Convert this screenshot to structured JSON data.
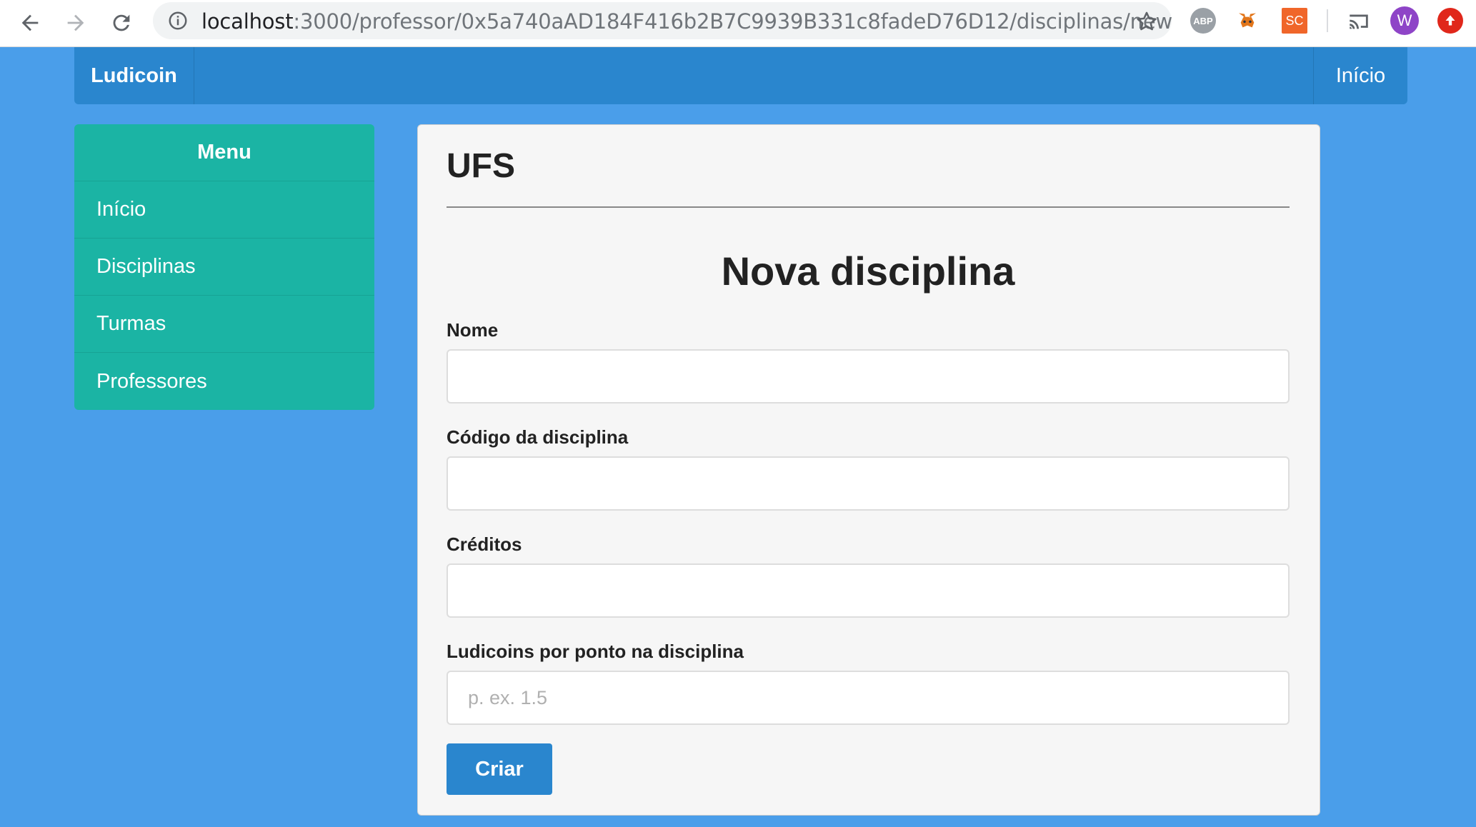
{
  "browser": {
    "url_host": "localhost",
    "url_path": ":3000/professor/0x5a740aAD184F416b2B7C9939B331c8fadeD76D12/disciplinas/new",
    "extensions": {
      "abp_label": "ABP",
      "sc_label": "SC",
      "avatar_letter": "W"
    }
  },
  "navbar": {
    "brand": "Ludicoin",
    "right_link": "Início"
  },
  "menu": {
    "header": "Menu",
    "items": [
      {
        "label": "Início"
      },
      {
        "label": "Disciplinas"
      },
      {
        "label": "Turmas"
      },
      {
        "label": "Professores"
      }
    ]
  },
  "main": {
    "institution": "UFS",
    "form_title": "Nova disciplina",
    "fields": [
      {
        "label": "Nome",
        "value": "",
        "placeholder": ""
      },
      {
        "label": "Código da disciplina",
        "value": "",
        "placeholder": ""
      },
      {
        "label": "Créditos",
        "value": "",
        "placeholder": ""
      },
      {
        "label": "Ludicoins por ponto na disciplina",
        "value": "",
        "placeholder": "p. ex. 1.5"
      }
    ],
    "submit_label": "Criar"
  },
  "colors": {
    "page_bg": "#4a9eea",
    "navbar_bg": "#2a86ce",
    "menu_bg": "#1bb4a4",
    "panel_bg": "#f6f6f6",
    "button_bg": "#2a86ce"
  }
}
